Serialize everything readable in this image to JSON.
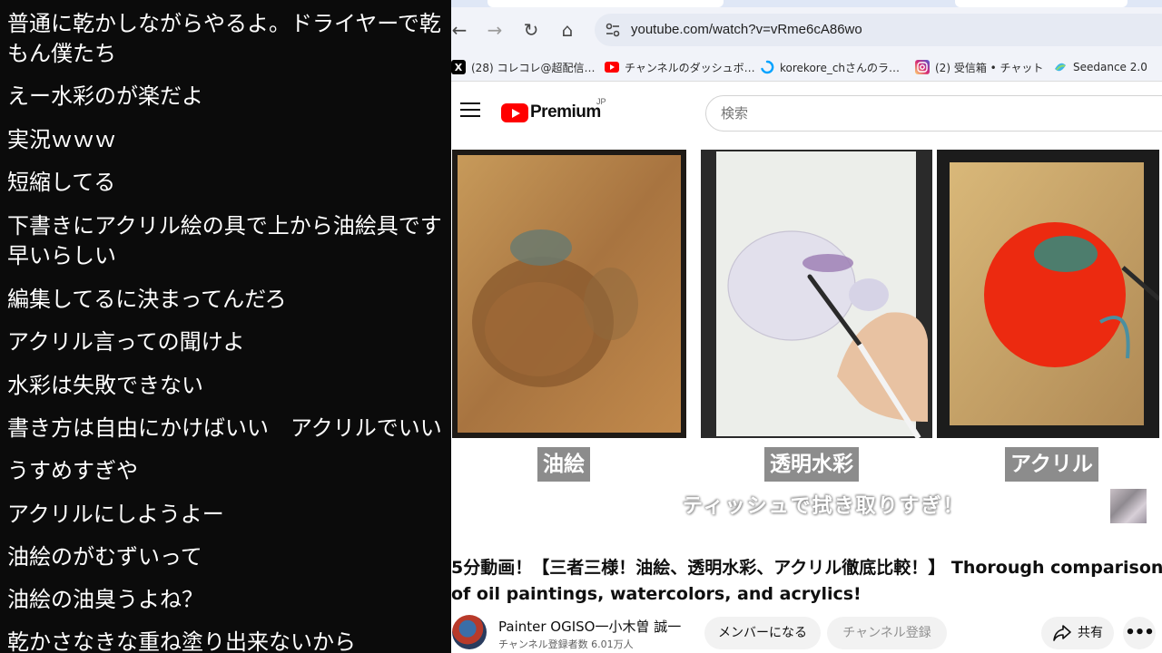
{
  "chat": {
    "lines": [
      {
        "text": "普通に乾かしながらやるよ。ドライヤーで乾"
      },
      {
        "text": "もん僕たち"
      },
      {
        "text": "えー水彩のが楽だよ"
      },
      {
        "text": "実況ｗｗｗ"
      },
      {
        "text": "短縮してる"
      },
      {
        "text": "下書きにアクリル絵の具で上から油絵具です"
      },
      {
        "text": "早いらしい"
      },
      {
        "text": "編集してるに決まってんだろ"
      },
      {
        "text": "アクリル言っての聞けよ"
      },
      {
        "text": "水彩は失敗できない"
      },
      {
        "text": "書き方は自由にかけばいい　アクリルでいい"
      },
      {
        "text": "うすめすぎや"
      },
      {
        "text": "アクリルにしようよー"
      },
      {
        "text": "油絵のがむずいって"
      },
      {
        "text": "油絵の油臭うよね？"
      },
      {
        "text": "乾かさなきな重ね塗り出来ないから"
      }
    ]
  },
  "browser": {
    "url": "youtube.com/watch?v=vRme6cA86wo",
    "nav": {
      "back": "←",
      "forward": "→",
      "reload": "↻",
      "home": "⌂"
    },
    "bookmarks": [
      {
        "label": "(28) コレコレ@超配信…",
        "icon": "x-icon",
        "color": "#000000"
      },
      {
        "label": "チャンネルのダッシュボ…",
        "icon": "youtube-icon",
        "color": "#ff0000"
      },
      {
        "label": "korekore_chさんのラ…",
        "icon": "loader-icon",
        "color": "#00a2ff"
      },
      {
        "label": "(2) 受信箱 • チャット",
        "icon": "instagram-icon",
        "color": "#d62976"
      },
      {
        "label": "Seedance 2.0",
        "icon": "seedance-icon",
        "color": "#3fb6e8"
      }
    ]
  },
  "youtube": {
    "logo_text": "Premium",
    "logo_region": "JP",
    "search_placeholder": "検索",
    "video": {
      "captions": [
        "油絵",
        "透明水彩",
        "アクリル"
      ],
      "subtitle": "ティッシュで拭き取りすぎ！"
    },
    "title_line1": "5分動画！【三者三様！油絵、透明水彩、アクリル徹底比較！】 Thorough comparison",
    "title_line2": "of oil paintings, watercolors, and acrylics!",
    "channel": {
      "name": "Painter OGISO一小木曽 誠一",
      "subscribers": "チャンネル登録者数 6.01万人"
    },
    "buttons": {
      "join": "メンバーになる",
      "subscribe": "チャンネル登録",
      "share": "共有",
      "more": "•••"
    }
  }
}
